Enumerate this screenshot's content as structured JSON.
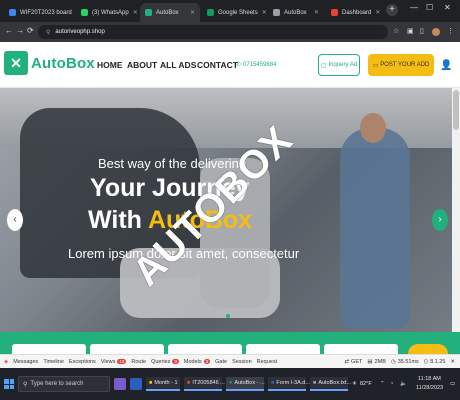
{
  "browser": {
    "tabs": [
      {
        "label": "WIF20T2023 board",
        "color": "#4285f4"
      },
      {
        "label": "(3) WhatsApp",
        "color": "#25d366"
      },
      {
        "label": "AutoBox",
        "color": "#22b07d",
        "active": true
      },
      {
        "label": "Google Sheets",
        "color": "#0f9d58"
      },
      {
        "label": "AutoBox",
        "color": "#9aa0a6"
      },
      {
        "label": "Dashboard",
        "color": "#e94235"
      }
    ],
    "url": "autoriveophp.shop"
  },
  "site": {
    "logo_text": "AutoBox",
    "nav": [
      "HOME",
      "ABOUT",
      "ALL ADS",
      "CONTACT"
    ],
    "phone": "0715459884",
    "inquiry_label": "Inquery Ad",
    "post_label": "POST YOUR ADD"
  },
  "hero": {
    "subtitle": "Best way of the delivering",
    "line1": "Your Journey",
    "line2_prefix": "With ",
    "line2_highlight": "AutoBox",
    "line3": "Lorem ipsum dolor sit amet, consectetur",
    "watermark": "AUTOBOX"
  },
  "debugbar": {
    "items": [
      {
        "label": "Messages"
      },
      {
        "label": "Timeline"
      },
      {
        "label": "Exceptions"
      },
      {
        "label": "Views",
        "badge": "13"
      },
      {
        "label": "Route"
      },
      {
        "label": "Queries",
        "badge": "3"
      },
      {
        "label": "Models",
        "badge": "3"
      },
      {
        "label": "Gate"
      },
      {
        "label": "Session"
      },
      {
        "label": "Request"
      }
    ],
    "method": "GET",
    "memory": "2MB",
    "time": "35.51ms",
    "version": "8.1.25"
  },
  "taskbar": {
    "search_placeholder": "Type here to search",
    "windows": [
      "Month - 1",
      "IT2005846 ...",
      "AutoBox - ...",
      "Form I-3A.d...",
      "AutoBox.txt..."
    ],
    "temperature": "82°F",
    "time": "11:18 AM",
    "date": "11/28/2023"
  },
  "colors": {
    "brand": "#22b07d",
    "accent": "#f5bd13"
  }
}
